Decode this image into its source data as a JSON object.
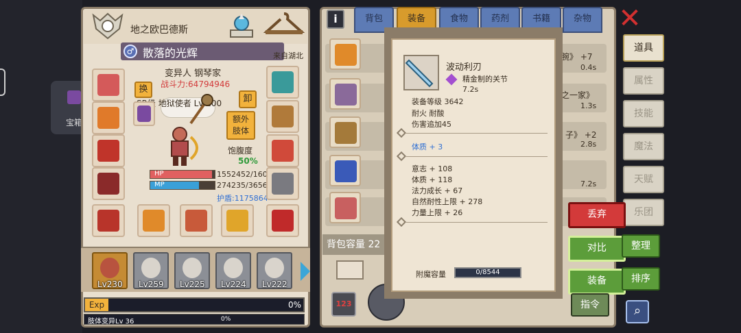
{
  "left_card": {
    "label": "宝箱"
  },
  "character": {
    "name": "地之欧巴德斯",
    "title": "散落的光辉",
    "from": "来自湖北",
    "job": "变异人 钢琴家",
    "power": "战斗力:64794946",
    "swap": "换",
    "unequip": "卸",
    "special_level": "SR级 地狱使者 Lv 100",
    "extra_body": "额外\n肢体",
    "satiety_label": "饱腹度",
    "satiety_value": "50%",
    "hp_label": "HP",
    "mp_label": "MP",
    "hp_value": "1552452/160",
    "mp_value": "274235/3656",
    "shield_value": "护盾:1175864",
    "hp_fraction": 0.96,
    "mp_fraction": 0.75
  },
  "team": [
    {
      "lv": "Lv230",
      "active": true
    },
    {
      "lv": "Lv259",
      "active": false
    },
    {
      "lv": "Lv225",
      "active": false
    },
    {
      "lv": "Lv224",
      "active": false
    },
    {
      "lv": "Lv222",
      "active": false
    }
  ],
  "exp": {
    "tag": "Exp",
    "pct": "0%",
    "body_label": "肢体变异Lv 36",
    "body_pct": "0%"
  },
  "inventory": {
    "tabs": [
      "背包",
      "装备",
      "食物",
      "药剂",
      "书籍",
      "杂物"
    ],
    "active_tab": 1,
    "rows": [
      {
        "text": "腕》 +7",
        "time": "0.4s"
      },
      {
        "text": "之一家》",
        "time": "1.3s"
      },
      {
        "text": "子》 +2",
        "time": "2.8s"
      },
      {
        "text": "",
        "time": "7.2s"
      },
      {
        "text": "",
        "time": ""
      }
    ],
    "bag_capacity": "背包容量 22"
  },
  "tooltip": {
    "name": "波动利刃",
    "enchant": "精金制的关节",
    "time": "7.2s",
    "equip_level": "装备等级 3642",
    "traits": "耐火 耐酸",
    "damage": "伤害追加45",
    "main_stat": "体质 + 3",
    "stats": [
      "意志 + 108",
      "体质 + 118",
      "法力成长 + 67",
      "自然耐性上限 + 278",
      "力量上限 + 26"
    ],
    "enchant_capacity_label": "附魔容量",
    "enchant_capacity": "0/8544"
  },
  "right_tabs": [
    "道具",
    "属性",
    "技能",
    "魔法",
    "天赋",
    "乐团"
  ],
  "actions": {
    "discard": "丢弃",
    "compare": "对比",
    "equip": "装备",
    "sort": "整理",
    "order": "排序",
    "command": "指令"
  },
  "number_btn": "123",
  "close": "✕"
}
